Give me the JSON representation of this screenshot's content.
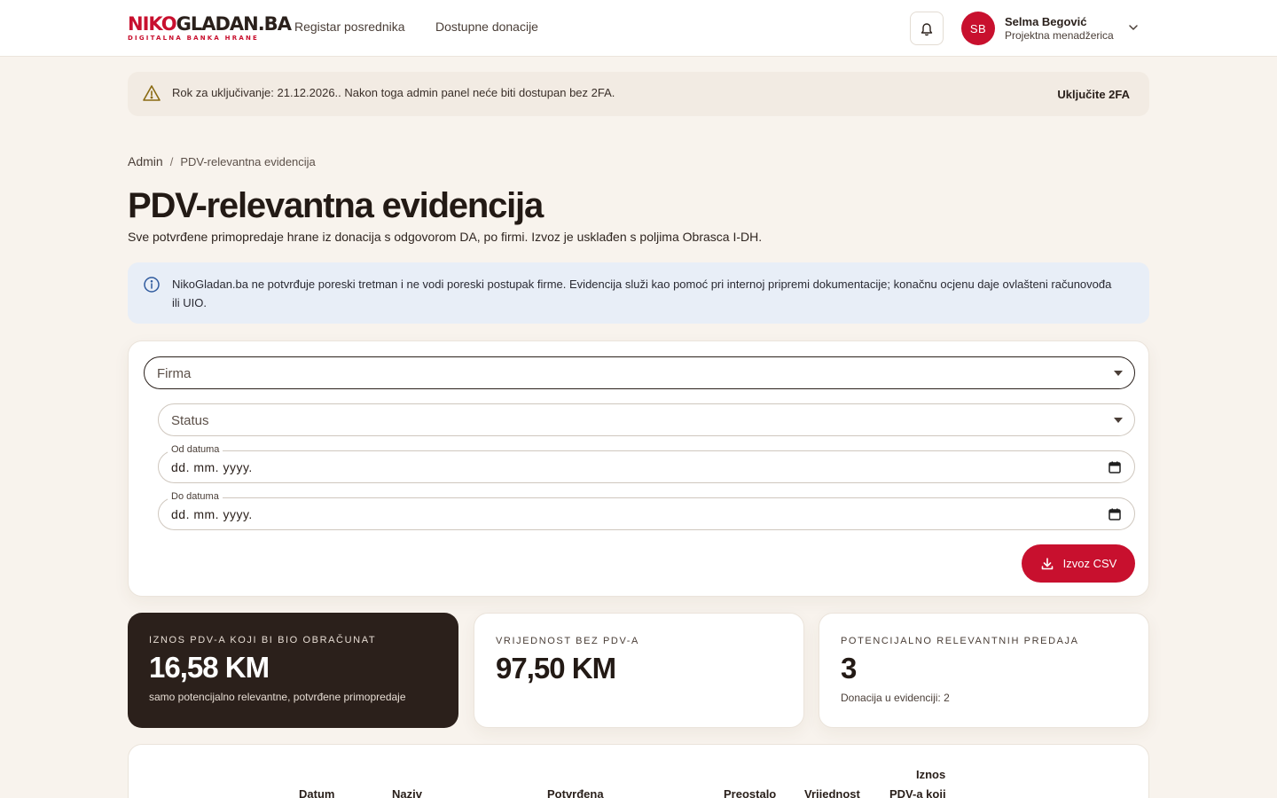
{
  "brand": {
    "logo_part1": "NIKO",
    "logo_part2": "GLADAN.BA",
    "tagline": "DIGITALNA BANKA HRANE",
    "accent_color": "#c8102e"
  },
  "nav": {
    "items": [
      {
        "label": "Registar posrednika"
      },
      {
        "label": "Dostupne donacije"
      }
    ],
    "notifications_icon": "bell-icon"
  },
  "user": {
    "initials": "SB",
    "name": "Selma Begović",
    "role": "Projektna menadžerica"
  },
  "warning": {
    "text": "Rok za uključivanje: 21.12.2026.. Nakon toga admin panel neće biti dostupan bez 2FA.",
    "action": "Uključite 2FA"
  },
  "breadcrumb": {
    "root": "Admin",
    "separator": "/",
    "current": "PDV-relevantna evidencija"
  },
  "page": {
    "title": "PDV-relevantna evidencija",
    "subtitle": "Sve potvrđene primopredaje hrane iz donacija s odgovorom DA, po firmi. Izvoz je usklađen s poljima Obrasca I-DH."
  },
  "info": {
    "text": "NikoGladan.ba ne potvrđuje poreski tretman i ne vodi poreski postupak firme. Evidencija služi kao pomoć pri internoj pripremi dokumentacije; konačnu ocjenu daje ovlašteni računovođa ili UIO."
  },
  "filters": {
    "firma_label": "Firma",
    "status_label": "Status",
    "date_from_label": "Od datuma",
    "date_from_value": "dd. mm. yyyy.",
    "date_to_label": "Do datuma",
    "date_to_value": "dd. mm. yyyy.",
    "export_label": "Izvoz CSV"
  },
  "stats": [
    {
      "caption": "IZNOS PDV-A KOJI BI BIO OBRAČUNAT",
      "value": "16,58 KM",
      "note": "samo potencijalno relevantne, potvrđene primopredaje"
    },
    {
      "caption": "VRIJEDNOST BEZ PDV-A",
      "value": "97,50 KM",
      "note": ""
    },
    {
      "caption": "POTENCIJALNO RELEVANTNIH PREDAJA",
      "value": "3",
      "note": "Donacija u evidenciji: 2"
    }
  ],
  "table": {
    "headers": [
      {
        "line1": "",
        "line2": "Datum"
      },
      {
        "line1": "",
        "line2": "Naziv"
      },
      {
        "line1": "",
        "line2": "Potvrđena"
      },
      {
        "line1": "",
        "line2": "Preostalo"
      },
      {
        "line1": "",
        "line2": "Vrijednost"
      },
      {
        "line1": "Iznos",
        "line2": "PDV-a koji"
      }
    ]
  }
}
